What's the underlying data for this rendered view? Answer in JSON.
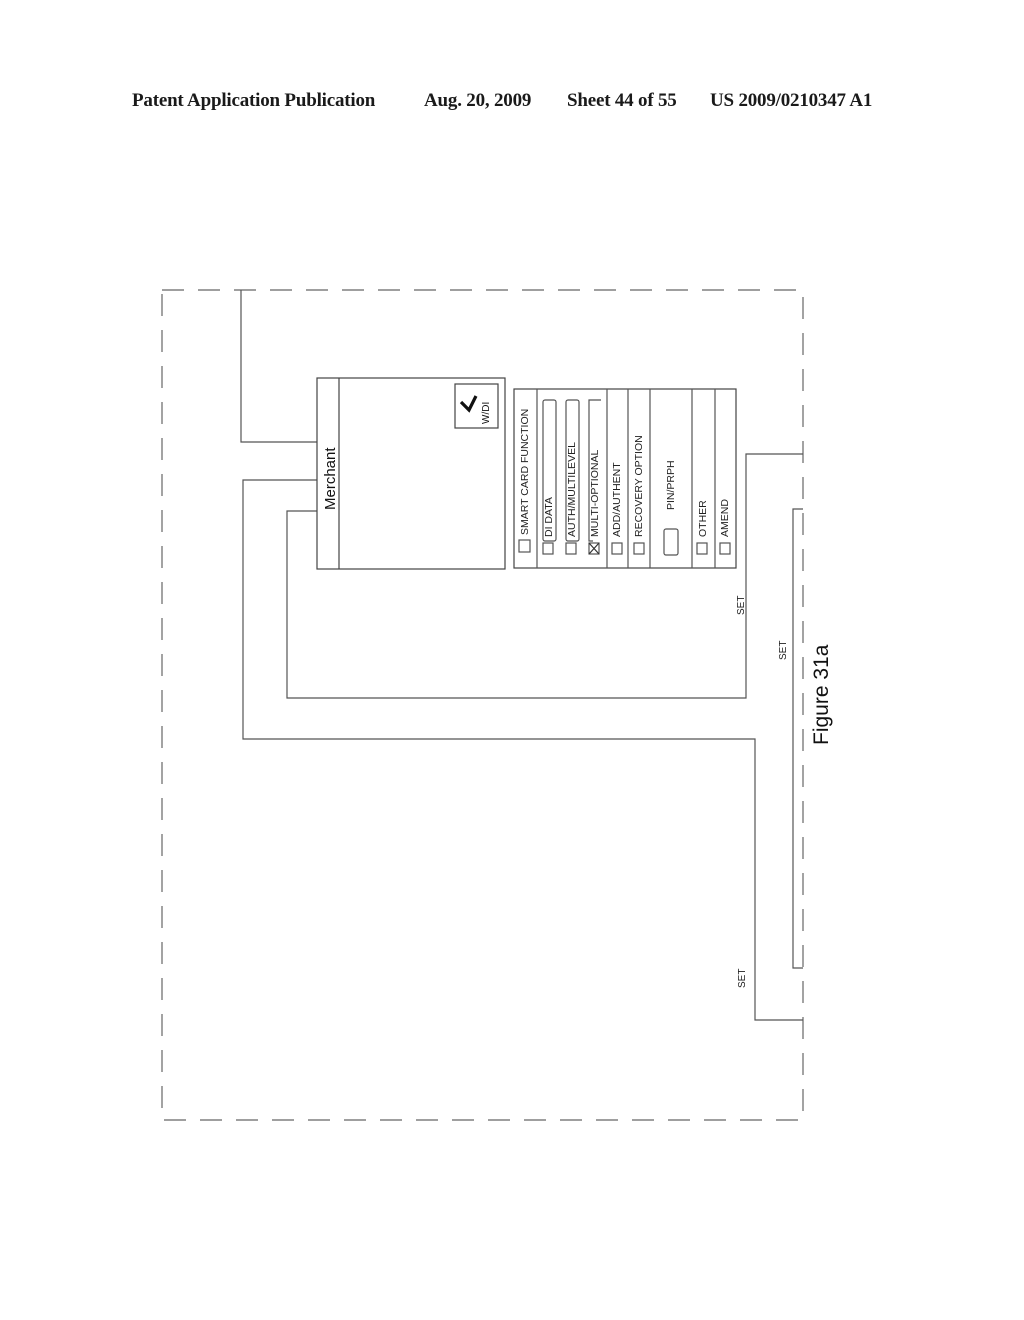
{
  "header": {
    "publication": "Patent Application Publication",
    "date": "Aug. 20, 2009",
    "sheet": "Sheet 44 of 55",
    "number": "US 2009/0210347 A1"
  },
  "figure": {
    "caption": "Figure 31a",
    "orientation": "rotated 90° counter-clockwise"
  },
  "merchant_panel": {
    "title": "Merchant",
    "wdi_button": {
      "label": "W/DI",
      "icon": "checkmark-icon",
      "checked": true
    }
  },
  "options_panel": {
    "items": [
      {
        "label": "SMART CARD FUNCTION",
        "checked": false,
        "type": "checkbox"
      },
      {
        "label": "DI DATA",
        "checked": false,
        "type": "checkbox-field"
      },
      {
        "label": "AUTH/MULTILEVEL",
        "checked": false,
        "type": "checkbox-field"
      },
      {
        "label": "MULTI-OPTIONAL",
        "checked": true,
        "type": "checkbox-field"
      },
      {
        "label": "ADD/AUTHENT",
        "checked": false,
        "type": "checkbox"
      },
      {
        "label": "RECOVERY OPTION",
        "checked": false,
        "type": "checkbox"
      },
      {
        "label": "PIN/PRPH",
        "type": "input"
      },
      {
        "label": "OTHER",
        "checked": false,
        "type": "checkbox"
      },
      {
        "label": "AMEND",
        "checked": false,
        "type": "checkbox"
      }
    ]
  },
  "connectors": {
    "set_label_1": "SET",
    "set_label_2": "SET",
    "set_label_3": "SET"
  }
}
